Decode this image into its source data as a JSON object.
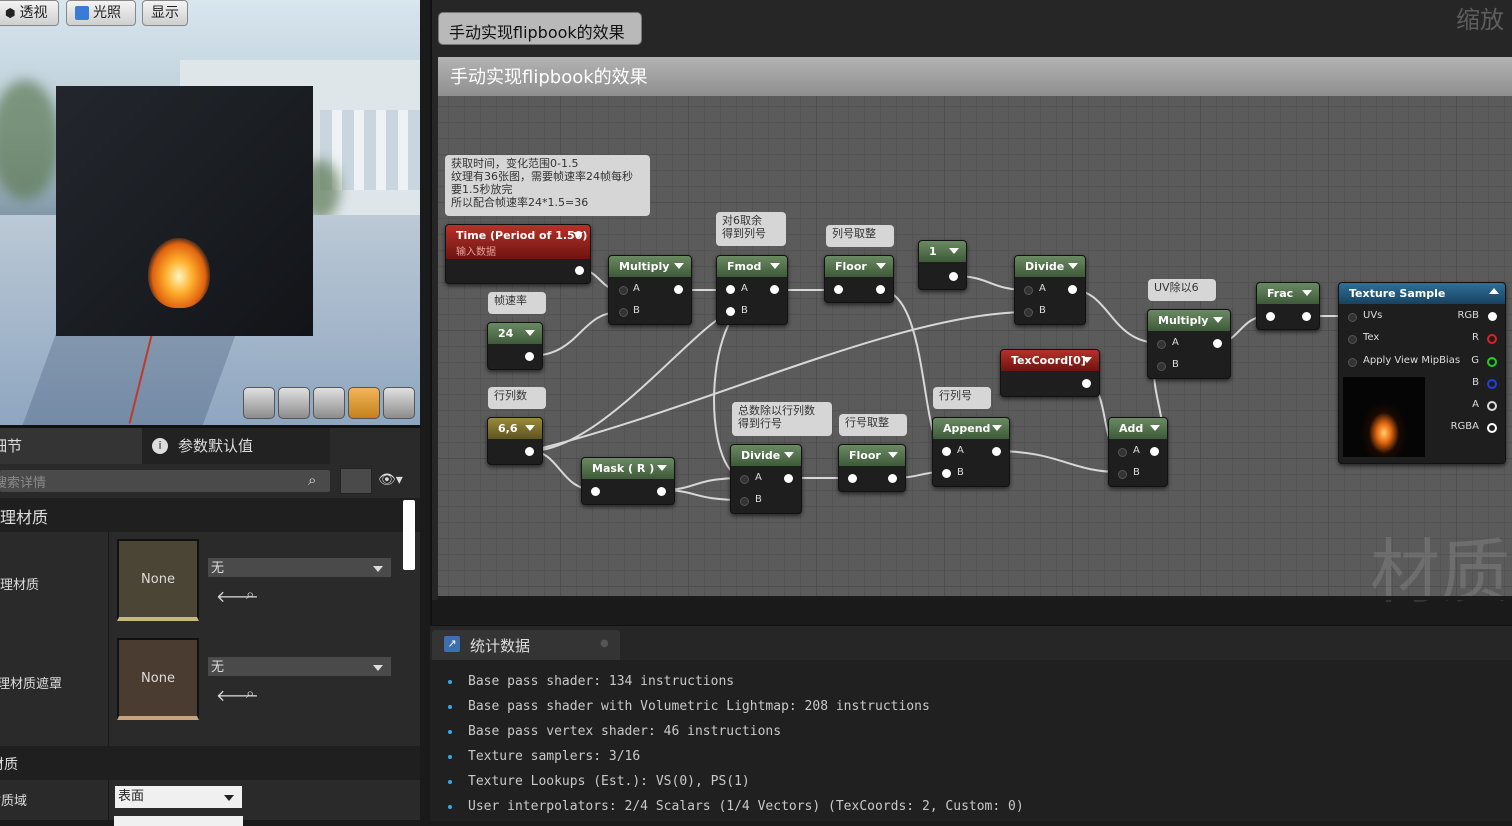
{
  "viewport": {
    "buttons": [
      "透视",
      "光照",
      "显示"
    ]
  },
  "left_panel": {
    "tab_details": "细节",
    "tab_params": "参数默认值",
    "search_placeholder": "搜索详情",
    "section_material": "物理材质",
    "row1_label": "物理材质",
    "row1_thumb": "None",
    "row1_value": "无",
    "row2_label": "物理材质遮罩",
    "row2_thumb": "None",
    "row2_value": "无",
    "section_material2": "材质",
    "domain_label": "材质域",
    "domain_value": "表面"
  },
  "graph": {
    "title_bubble": "手动实现flipbook的效果",
    "title_bar": "手动实现flipbook的效果",
    "zoom_label": "缩放",
    "watermark": "材质",
    "comments": {
      "c_time": "获取时间，变化范围0-1.5\n纹理有36张图，需要帧速率24帧每秒\n要1.5秒放完\n所以配合帧速率24*1.5=36",
      "c_fmod": "对6取余\n得到列号",
      "c_colfloor": "列号取整",
      "c_framerate": "帧速率",
      "c_rowcol": "行列数",
      "c_rowdiv": "总数除以行列数\n得到行号",
      "c_rowfloor": "行号取整",
      "c_rowcolnum": "行列号",
      "c_uvdiv": "UV除以6"
    },
    "nodes": {
      "time": "Time (Period of 1.50)",
      "time_sub": "输入数据",
      "multiply1": "Multiply",
      "fmod": "Fmod",
      "floor1": "Floor",
      "const1": "1",
      "divide1": "Divide",
      "frac": "Frac",
      "texsample": "Texture Sample",
      "const24": "24",
      "const66": "6,6",
      "mask": "Mask ( R )",
      "divide2": "Divide",
      "floor2": "Floor",
      "append": "Append",
      "texcoord": "TexCoord[0]",
      "multiply2": "Multiply",
      "add": "Add"
    },
    "pins": {
      "a": "A",
      "b": "B",
      "uvs": "UVs",
      "tex": "Tex",
      "mipbias": "Apply View MipBias",
      "rgb": "RGB",
      "r": "R",
      "g": "G",
      "bb": "B",
      "aa": "A",
      "rgba": "RGBA"
    }
  },
  "stats": {
    "tab": "统计数据",
    "lines": [
      "Base pass shader: 134 instructions",
      "Base pass shader with Volumetric Lightmap: 208 instructions",
      "Base pass vertex shader: 46 instructions",
      "Texture samplers: 3/16",
      "Texture Lookups (Est.): VS(0), PS(1)",
      "User interpolators: 2/4 Scalars (1/4 Vectors) (TexCoords: 2, Custom: 0)"
    ]
  }
}
